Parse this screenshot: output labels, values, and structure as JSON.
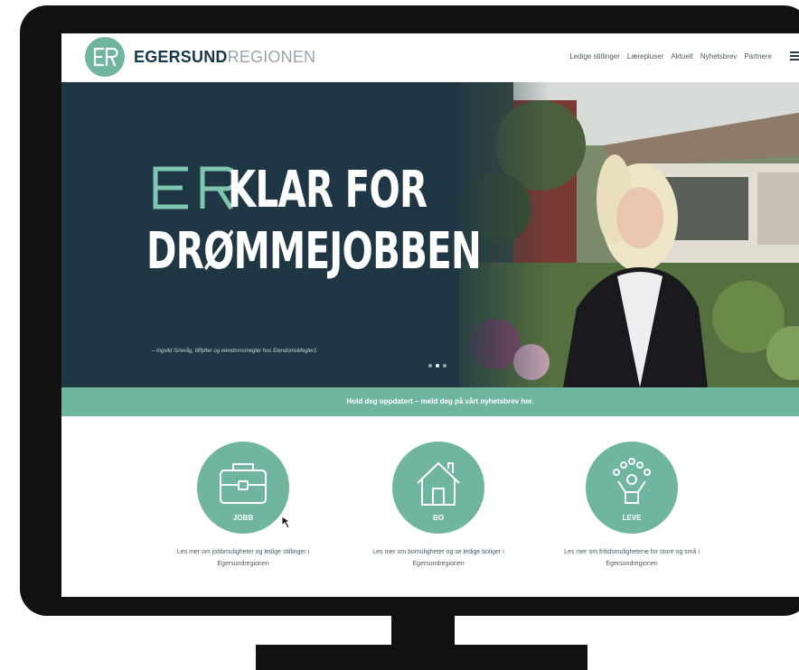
{
  "brand": {
    "bold": "EGERSUND",
    "light": "REGIONEN",
    "logo_letters": "ER"
  },
  "nav": [
    "Ledige stillinger",
    "Lærepluser",
    "Aktuelt",
    "Nyhetsbrev",
    "Partnere"
  ],
  "hero": {
    "title_line1": "KLAR FOR",
    "title_line2": "DRØMMEJOBBEN",
    "caption": "– Ingvild Sirevåg, tilflytter og eiendomsmegler hos EiendomsMegler1",
    "slides": 3,
    "active_slide": 1
  },
  "newsletter": {
    "text": "Hold deg oppdatert – meld deg på vårt nyhetsbrev her."
  },
  "features": [
    {
      "label": "JOBB",
      "icon": "briefcase-icon",
      "text": "Les mer om jobbmuligheter og ledige stillinger i Egersundregionen"
    },
    {
      "label": "BO",
      "icon": "house-icon",
      "text": "Les mer om bomuligheter og se ledige boliger i Egersundregionen"
    },
    {
      "label": "LEVE",
      "icon": "people-cheer-icon",
      "text": "Les mer om fritidsmulighetene for store og små i Egersundregionen"
    }
  ],
  "colors": {
    "accent": "#6fb5a0",
    "navy": "#1f3744",
    "frame": "#111111"
  }
}
